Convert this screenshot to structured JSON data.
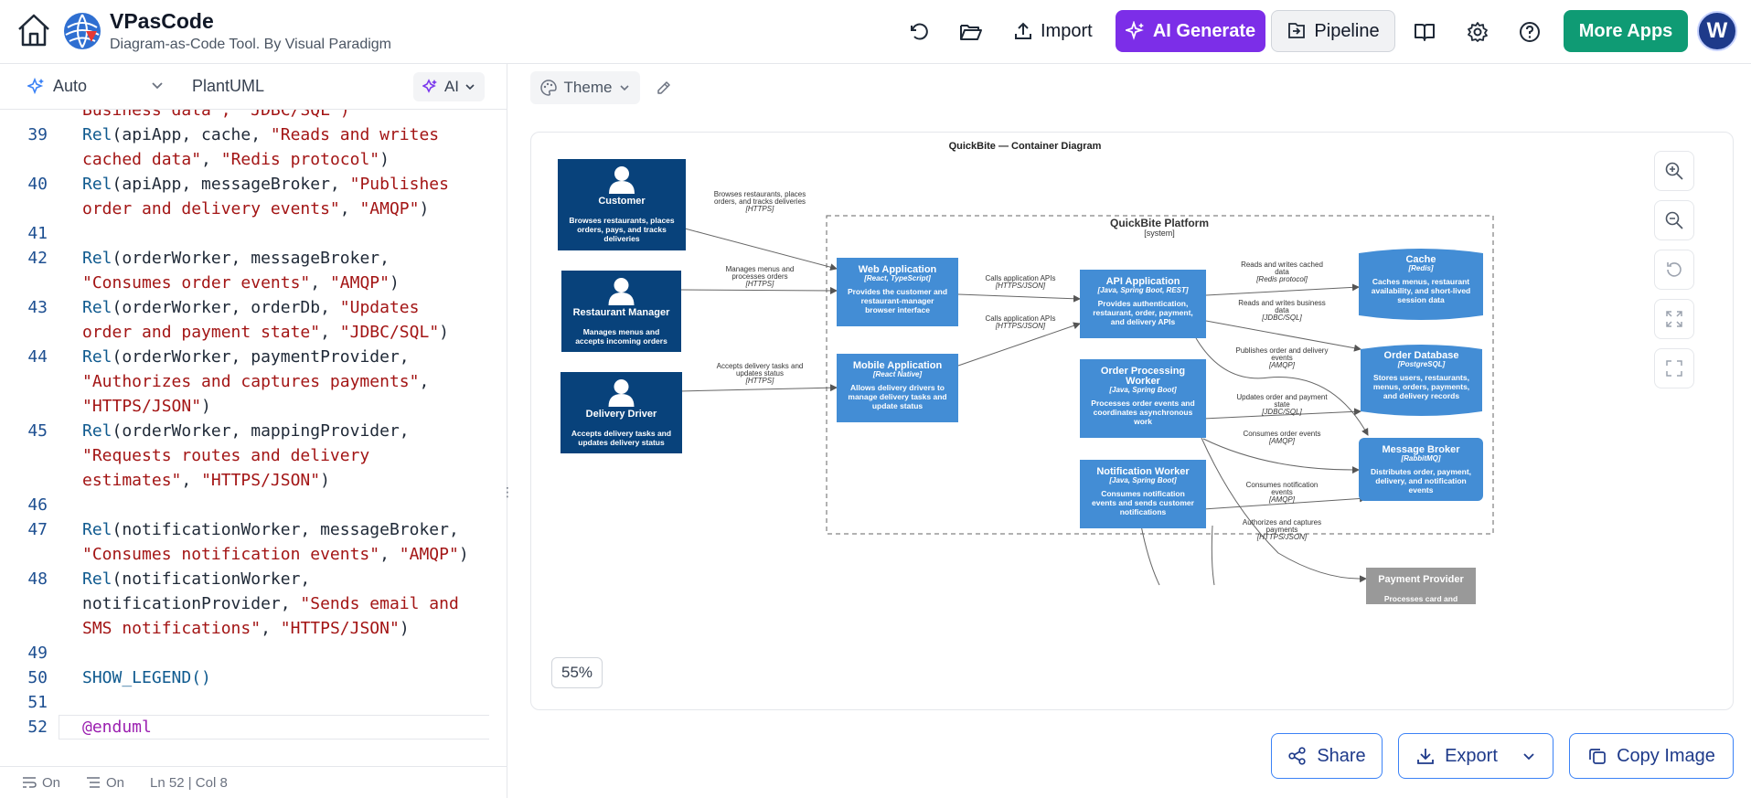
{
  "header": {
    "app_title": "VPasCode",
    "app_subtitle": "Diagram-as-Code Tool. By Visual Paradigm",
    "import_label": "Import",
    "ai_generate_label": "AI Generate",
    "pipeline_label": "Pipeline",
    "more_apps_label": "More Apps",
    "avatar_letter": "W"
  },
  "editor": {
    "mode_label": "Auto",
    "language_label": "PlantUML",
    "ai_label": "AI",
    "lines": [
      {
        "n": "",
        "segs": [
          [
            "s",
            "Business data\", \"JDBC/SQL\")"
          ]
        ]
      },
      {
        "n": "39",
        "segs": [
          [
            "f",
            "Rel"
          ],
          [
            "p",
            "(apiApp, cache, "
          ],
          [
            "s",
            "\"Reads and writes"
          ]
        ]
      },
      {
        "n": "",
        "segs": [
          [
            "s",
            "cached data\""
          ],
          [
            "p",
            ", "
          ],
          [
            "s",
            "\"Redis protocol\""
          ],
          [
            "p",
            ")"
          ]
        ]
      },
      {
        "n": "40",
        "segs": [
          [
            "f",
            "Rel"
          ],
          [
            "p",
            "(apiApp, messageBroker, "
          ],
          [
            "s",
            "\"Publishes"
          ]
        ]
      },
      {
        "n": "",
        "segs": [
          [
            "s",
            "order and delivery events\""
          ],
          [
            "p",
            ", "
          ],
          [
            "s",
            "\"AMQP\""
          ],
          [
            "p",
            ")"
          ]
        ]
      },
      {
        "n": "41",
        "segs": []
      },
      {
        "n": "42",
        "segs": [
          [
            "f",
            "Rel"
          ],
          [
            "p",
            "(orderWorker, messageBroker,"
          ]
        ]
      },
      {
        "n": "",
        "segs": [
          [
            "s",
            "\"Consumes order events\""
          ],
          [
            "p",
            ", "
          ],
          [
            "s",
            "\"AMQP\""
          ],
          [
            "p",
            ")"
          ]
        ]
      },
      {
        "n": "43",
        "segs": [
          [
            "f",
            "Rel"
          ],
          [
            "p",
            "(orderWorker, orderDb, "
          ],
          [
            "s",
            "\"Updates"
          ]
        ]
      },
      {
        "n": "",
        "segs": [
          [
            "s",
            "order and payment state\""
          ],
          [
            "p",
            ", "
          ],
          [
            "s",
            "\"JDBC/SQL\""
          ],
          [
            "p",
            ")"
          ]
        ]
      },
      {
        "n": "44",
        "segs": [
          [
            "f",
            "Rel"
          ],
          [
            "p",
            "(orderWorker, paymentProvider,"
          ]
        ]
      },
      {
        "n": "",
        "segs": [
          [
            "s",
            "\"Authorizes and captures payments\""
          ],
          [
            "p",
            ","
          ]
        ]
      },
      {
        "n": "",
        "segs": [
          [
            "s",
            "\"HTTPS/JSON\""
          ],
          [
            "p",
            ")"
          ]
        ]
      },
      {
        "n": "45",
        "segs": [
          [
            "f",
            "Rel"
          ],
          [
            "p",
            "(orderWorker, mappingProvider,"
          ]
        ]
      },
      {
        "n": "",
        "segs": [
          [
            "s",
            "\"Requests routes and delivery"
          ]
        ]
      },
      {
        "n": "",
        "segs": [
          [
            "s",
            "estimates\""
          ],
          [
            "p",
            ", "
          ],
          [
            "s",
            "\"HTTPS/JSON\""
          ],
          [
            "p",
            ")"
          ]
        ]
      },
      {
        "n": "46",
        "segs": []
      },
      {
        "n": "47",
        "segs": [
          [
            "f",
            "Rel"
          ],
          [
            "p",
            "(notificationWorker, messageBroker,"
          ]
        ]
      },
      {
        "n": "",
        "segs": [
          [
            "s",
            "\"Consumes notification events\""
          ],
          [
            "p",
            ", "
          ],
          [
            "s",
            "\"AMQP\""
          ],
          [
            "p",
            ")"
          ]
        ]
      },
      {
        "n": "48",
        "segs": [
          [
            "f",
            "Rel"
          ],
          [
            "p",
            "(notificationWorker,"
          ]
        ]
      },
      {
        "n": "",
        "segs": [
          [
            "p",
            "notificationProvider, "
          ],
          [
            "s",
            "\"Sends email and"
          ]
        ]
      },
      {
        "n": "",
        "segs": [
          [
            "s",
            "SMS notifications\""
          ],
          [
            "p",
            ", "
          ],
          [
            "s",
            "\"HTTPS/JSON\""
          ],
          [
            "p",
            ")"
          ]
        ]
      },
      {
        "n": "49",
        "segs": []
      },
      {
        "n": "50",
        "segs": [
          [
            "f",
            "SHOW_LEGEND()"
          ]
        ]
      },
      {
        "n": "51",
        "segs": []
      },
      {
        "n": "52",
        "segs": [
          [
            "k",
            "@enduml"
          ]
        ]
      }
    ],
    "status": {
      "wrap_state": "On",
      "lint_state": "On",
      "cursor": "Ln 52 | Col 8"
    }
  },
  "canvas": {
    "theme_label": "Theme",
    "zoom_level": "55%"
  },
  "diagram": {
    "title": "QuickBite — Container Diagram",
    "boundary_label": "QuickBite Platform",
    "boundary_type": "[system]",
    "persons": [
      {
        "id": "customer",
        "name": "Customer",
        "desc": [
          "Browses restaurants, places",
          "orders, pays, and tracks",
          "deliveries"
        ]
      },
      {
        "id": "restaurant",
        "name": "Restaurant Manager",
        "desc": [
          "Manages menus and",
          "accepts incoming orders"
        ]
      },
      {
        "id": "driver",
        "name": "Delivery Driver",
        "desc": [
          "Accepts delivery tasks and",
          "updates delivery status"
        ]
      }
    ],
    "containers": [
      {
        "id": "web",
        "name": "Web Application",
        "tech": "[React, TypeScript]",
        "desc": [
          "Provides the customer and",
          "restaurant-manager",
          "browser interface"
        ]
      },
      {
        "id": "mobile",
        "name": "Mobile Application",
        "tech": "[React Native]",
        "desc": [
          "Allows delivery drivers to",
          "manage delivery tasks and",
          "update status"
        ]
      },
      {
        "id": "api",
        "name": "API Application",
        "tech": "[Java, Spring Boot, REST]",
        "desc": [
          "Provides authentication,",
          "restaurant, order, payment,",
          "and delivery APIs"
        ]
      },
      {
        "id": "orderWorker",
        "name": [
          "Order Processing",
          "Worker"
        ],
        "tech": "[Java, Spring Boot]",
        "desc": [
          "Processes order events and",
          "coordinates asynchronous",
          "work"
        ]
      },
      {
        "id": "notifWorker",
        "name": "Notification Worker",
        "tech": "[Java, Spring Boot]",
        "desc": [
          "Consumes notification",
          "events and sends customer",
          "notifications"
        ]
      },
      {
        "id": "cache",
        "name": "Cache",
        "tech": "[Redis]",
        "desc": [
          "Caches menus, restaurant",
          "availability, and short-lived",
          "session data"
        ]
      },
      {
        "id": "orderDb",
        "name": "Order Database",
        "tech": "[PostgreSQL]",
        "desc": [
          "Stores users, restaurants,",
          "menus, orders, payments,",
          "and delivery records"
        ]
      },
      {
        "id": "broker",
        "name": "Message Broker",
        "tech": "[RabbitMQ]",
        "desc": [
          "Distributes order, payment,",
          "delivery, and notification",
          "events"
        ]
      }
    ],
    "external": {
      "name": "Payment Provider",
      "desc": [
        "Processes card and"
      ]
    },
    "relations": [
      {
        "label": [
          "Browses restaurants, places",
          "orders, and tracks deliveries"
        ],
        "tech": "[HTTPS]"
      },
      {
        "label": [
          "Manages menus and",
          "processes orders"
        ],
        "tech": "[HTTPS]"
      },
      {
        "label": [
          "Accepts delivery tasks and",
          "updates status"
        ],
        "tech": "[HTTPS]"
      },
      {
        "label": [
          "Calls application APIs"
        ],
        "tech": "[HTTPS/JSON]"
      },
      {
        "label": [
          "Calls application APIs"
        ],
        "tech": "[HTTPS/JSON]"
      },
      {
        "label": [
          "Reads and writes cached",
          "data"
        ],
        "tech": "[Redis protocol]"
      },
      {
        "label": [
          "Reads and writes business",
          "data"
        ],
        "tech": "[JDBC/SQL]"
      },
      {
        "label": [
          "Publishes order and delivery",
          "events"
        ],
        "tech": "[AMQP]"
      },
      {
        "label": [
          "Updates order and payment",
          "state"
        ],
        "tech": "[JDBC/SQL]"
      },
      {
        "label": [
          "Consumes order events"
        ],
        "tech": "[AMQP]"
      },
      {
        "label": [
          "Consumes notification",
          "events"
        ],
        "tech": "[AMQP]"
      },
      {
        "label": [
          "Authorizes and captures",
          "payments"
        ],
        "tech": "[HTTPS/JSON]"
      }
    ]
  },
  "footer": {
    "share_label": "Share",
    "export_label": "Export",
    "copy_label": "Copy Image"
  },
  "colors": {
    "person": "#08427b",
    "container": "#438dd5",
    "external": "#999999",
    "ai_purple": "#7c2ee8",
    "more_green": "#0f9b74"
  }
}
